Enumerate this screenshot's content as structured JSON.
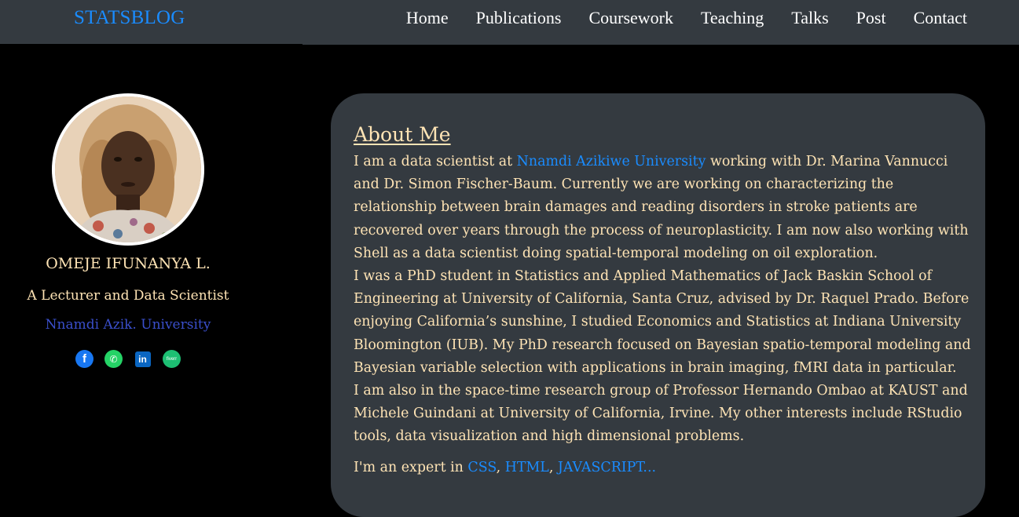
{
  "navbar": {
    "brand": "STATSBLOG",
    "links": [
      "Home",
      "Publications",
      "Coursework",
      "Teaching",
      "Talks",
      "Post",
      "Contact"
    ]
  },
  "sidebar": {
    "name": "OMEJE IFUNANYA L.",
    "role": "A Lecturer and Data Scientist",
    "university": "Nnamdi Azik. University",
    "socials": [
      {
        "icon": "facebook-icon",
        "glyph": "f"
      },
      {
        "icon": "whatsapp-icon",
        "glyph": "✆"
      },
      {
        "icon": "linkedin-icon",
        "glyph": "in"
      },
      {
        "icon": "fiverr-icon",
        "glyph": "fiverr"
      }
    ]
  },
  "about": {
    "title": "About Me",
    "p1_before": "I am a data scientist at ",
    "p1_link": "Nnamdi Azikiwe University",
    "p1_after": " working with Dr. Marina Vannucci and Dr. Simon Fischer-Baum. Currently we are working on characterizing the relationship between brain damages and reading disorders in stroke patients are recovered over years through the process of neuroplasticity. I am now also working with Shell as a data scientist doing spatial-temporal modeling on oil exploration.",
    "p2": "I was a PhD student in Statistics and Applied Mathematics of Jack Baskin School of Engineering at University of California, Santa Cruz, advised by Dr. Raquel Prado. Before enjoying California’s sunshine, I studied Economics and Statistics at Indiana University Bloomington (IUB). My PhD research focused on Bayesian spatio-temporal modeling and Bayesian variable selection with applications in brain imaging, fMRI data in particular.",
    "p3": "I am also in the space-time research group of Professor Hernando Ombao at KAUST and Michele Guindani at University of California, Irvine. My other interests include RStudio tools, data visualization and high dimensional problems.",
    "expert_prefix": "I'm an expert in ",
    "skill1": "CSS",
    "sep1": ", ",
    "skill2": "HTML",
    "sep2": ", ",
    "skill3": "JAVASCRIPT..."
  },
  "colors": {
    "navbar_bg": "#343a40",
    "page_bg": "#000000",
    "card_bg": "#343a40",
    "text": "#ffe4b5",
    "link": "#1a8cff",
    "university": "#3a4fcc"
  }
}
